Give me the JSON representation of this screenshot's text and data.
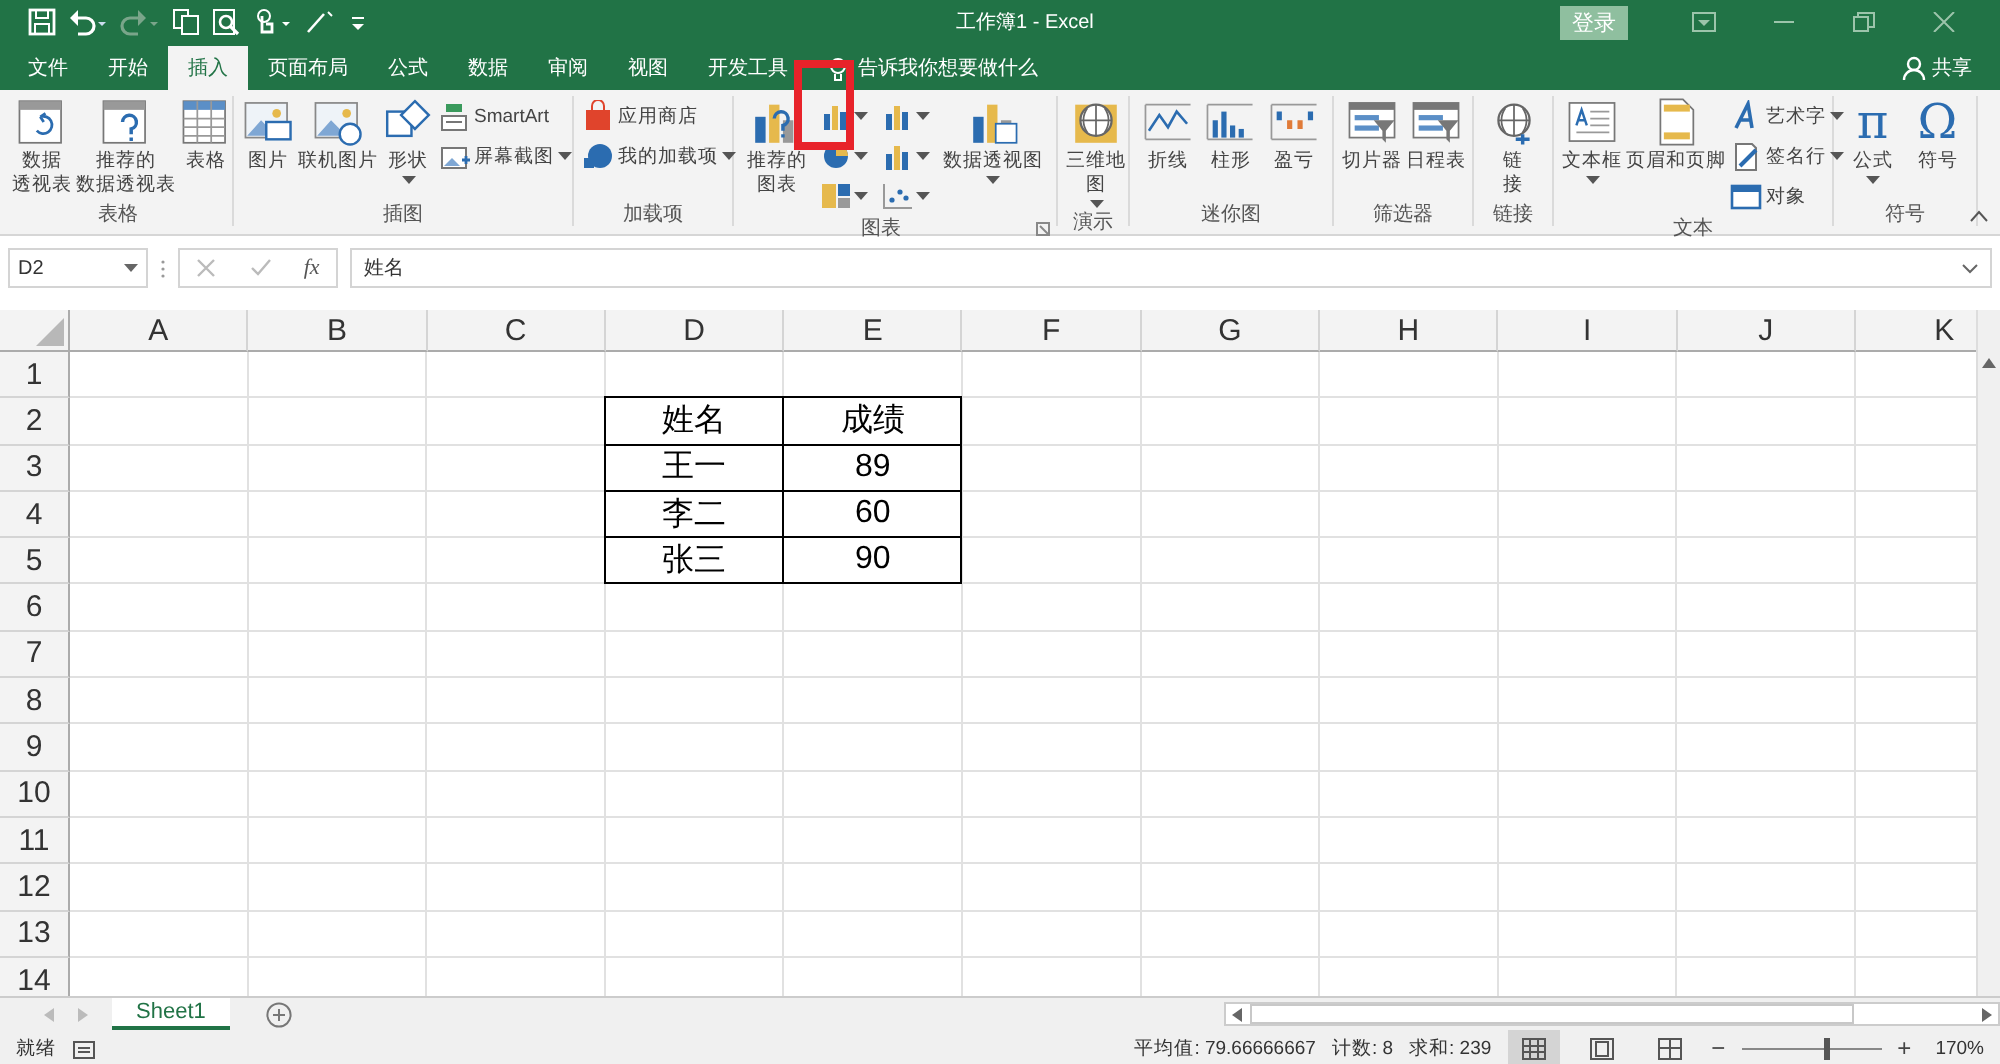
{
  "window": {
    "title": "工作簿1 - Excel",
    "sign_in": "登录"
  },
  "tabs": [
    {
      "label": "文件",
      "selected": false
    },
    {
      "label": "开始",
      "selected": false
    },
    {
      "label": "插入",
      "selected": true
    },
    {
      "label": "页面布局",
      "selected": false
    },
    {
      "label": "公式",
      "selected": false
    },
    {
      "label": "数据",
      "selected": false
    },
    {
      "label": "审阅",
      "selected": false
    },
    {
      "label": "视图",
      "selected": false
    },
    {
      "label": "开发工具",
      "selected": false
    }
  ],
  "tell_me": "告诉我你想要做什么",
  "share": "共享",
  "ribbon": {
    "groups": [
      {
        "label": "表格",
        "items": [
          {
            "kind": "large",
            "lines": [
              "数据",
              "透视表"
            ],
            "dropdown": false
          },
          {
            "kind": "large",
            "lines": [
              "推荐的",
              "数据透视表"
            ],
            "dropdown": false
          },
          {
            "kind": "large",
            "lines": [
              "表格"
            ],
            "dropdown": false
          }
        ]
      },
      {
        "label": "插图",
        "items": [
          {
            "kind": "large",
            "lines": [
              "图片"
            ],
            "dropdown": false
          },
          {
            "kind": "large",
            "lines": [
              "联机图片"
            ],
            "dropdown": false
          },
          {
            "kind": "large",
            "lines": [
              "形状"
            ],
            "dropdown": true
          },
          {
            "kind": "stack",
            "items": [
              {
                "kind": "small",
                "label": "SmartArt",
                "dropdown": false
              },
              {
                "kind": "small",
                "label": "屏幕截图",
                "dropdown": true
              }
            ]
          }
        ]
      },
      {
        "label": "加载项",
        "items": [
          {
            "kind": "stack",
            "items": [
              {
                "kind": "small",
                "label": "应用商店",
                "dropdown": false
              },
              {
                "kind": "small",
                "label": "我的加载项",
                "dropdown": true
              }
            ]
          }
        ]
      },
      {
        "label": "图表",
        "launcher": true,
        "items": [
          {
            "kind": "large",
            "lines": [
              "推荐的",
              "图表"
            ],
            "dropdown": false
          },
          {
            "kind": "stack",
            "items": [
              {
                "kind": "icon",
                "dropdown": true
              },
              {
                "kind": "icon",
                "dropdown": true
              },
              {
                "kind": "icon",
                "dropdown": true
              }
            ]
          },
          {
            "kind": "stack",
            "items": [
              {
                "kind": "icon",
                "dropdown": true
              },
              {
                "kind": "icon",
                "dropdown": true
              },
              {
                "kind": "icon",
                "dropdown": true
              }
            ]
          },
          {
            "kind": "large",
            "lines": [
              "数据透视图"
            ],
            "dropdown": true
          }
        ]
      },
      {
        "label": "演示",
        "items": [
          {
            "kind": "large",
            "lines": [
              "三维地",
              "图"
            ],
            "dropdown": true
          }
        ]
      },
      {
        "label": "迷你图",
        "items": [
          {
            "kind": "large",
            "lines": [
              "折线"
            ],
            "dropdown": false
          },
          {
            "kind": "large",
            "lines": [
              "柱形"
            ],
            "dropdown": false
          },
          {
            "kind": "large",
            "lines": [
              "盈亏"
            ],
            "dropdown": false
          }
        ]
      },
      {
        "label": "筛选器",
        "items": [
          {
            "kind": "large",
            "lines": [
              "切片器"
            ],
            "dropdown": false
          },
          {
            "kind": "large",
            "lines": [
              "日程表"
            ],
            "dropdown": false
          }
        ]
      },
      {
        "label": "链接",
        "items": [
          {
            "kind": "large",
            "lines": [
              "链",
              "接"
            ],
            "dropdown": false
          }
        ]
      },
      {
        "label": "文本",
        "items": [
          {
            "kind": "large",
            "lines": [
              "文本框"
            ],
            "dropdown": true
          },
          {
            "kind": "large",
            "lines": [
              "页眉和页脚"
            ],
            "dropdown": false
          },
          {
            "kind": "stack",
            "items": [
              {
                "kind": "small",
                "label": "艺术字",
                "dropdown": true
              },
              {
                "kind": "small",
                "label": "签名行",
                "dropdown": true
              },
              {
                "kind": "small",
                "label": "对象",
                "dropdown": false
              }
            ]
          }
        ]
      },
      {
        "label": "符号",
        "items": [
          {
            "kind": "glyph",
            "glyph": "π",
            "lines": [
              "公式"
            ],
            "dropdown": true
          },
          {
            "kind": "glyph",
            "glyph": "Ω",
            "lines": [
              "符号"
            ],
            "dropdown": false
          }
        ]
      }
    ]
  },
  "formula_bar": {
    "name_box": "D2",
    "function_label": "fx",
    "value": "姓名"
  },
  "columns": [
    "A",
    "B",
    "C",
    "D",
    "E",
    "F",
    "G",
    "H",
    "I",
    "J",
    "K"
  ],
  "rows": [
    {
      "label": "1"
    },
    {
      "label": "2"
    },
    {
      "label": "3"
    },
    {
      "label": "4"
    },
    {
      "label": "5"
    },
    {
      "label": "6"
    },
    {
      "label": "7"
    },
    {
      "label": "8"
    },
    {
      "label": "9"
    },
    {
      "label": "10"
    },
    {
      "label": "11"
    },
    {
      "label": "12"
    },
    {
      "label": "13"
    },
    {
      "label": "14"
    }
  ],
  "table": {
    "rows": [
      {
        "cells": [
          "姓名",
          "成绩"
        ]
      },
      {
        "cells": [
          "王一",
          "89"
        ]
      },
      {
        "cells": [
          "李二",
          "60"
        ]
      },
      {
        "cells": [
          "张三",
          "90"
        ]
      }
    ]
  },
  "sheets": [
    {
      "label": "Sheet1",
      "selected": true
    }
  ],
  "status": {
    "ready": "就绪",
    "average": "平均值: 79.66666667",
    "count": "计数: 8",
    "sum": "求和: 239",
    "views": [
      {
        "selected": true
      },
      {
        "selected": false
      },
      {
        "selected": false
      }
    ],
    "zoom": {
      "zoom_out": "−",
      "zoom_in": "+",
      "level": 0.6,
      "reading": "170%"
    }
  }
}
